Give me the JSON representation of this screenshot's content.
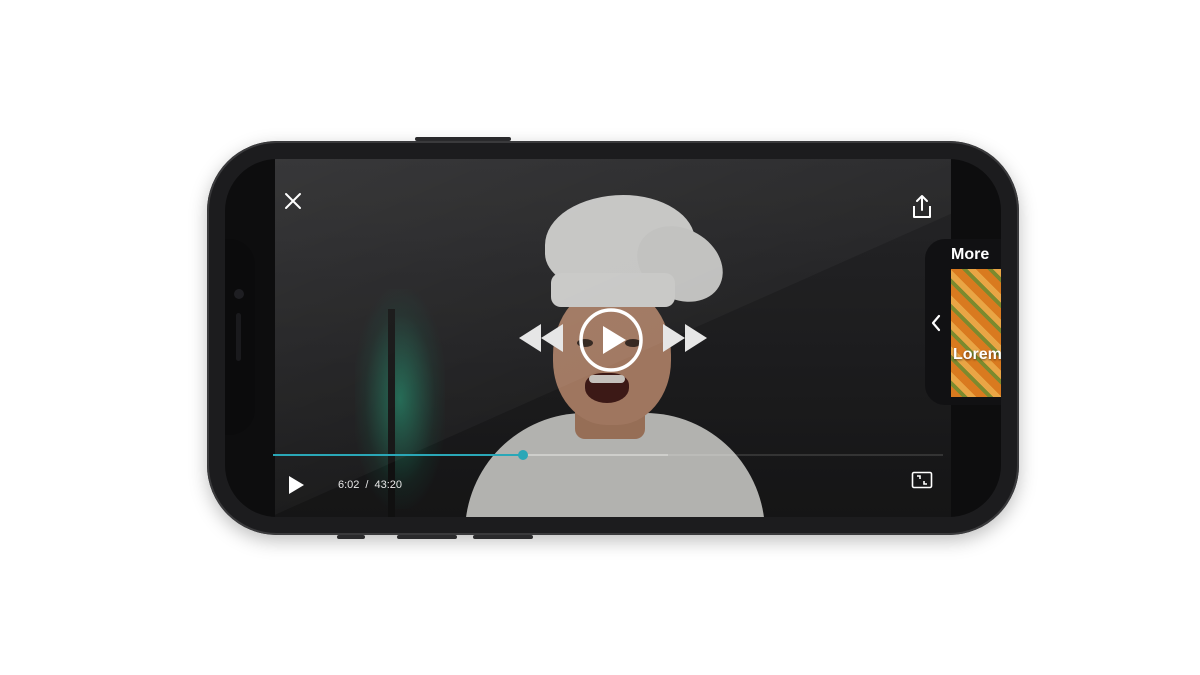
{
  "player": {
    "current_time": "6:02",
    "separator": "/",
    "duration": "43:20",
    "progress_fraction": 0.373,
    "buffer_fraction": 0.59,
    "accent_color": "#2aa7b7"
  },
  "icons": {
    "close": "close-icon",
    "share": "share-icon",
    "rewind": "rewind-icon",
    "play": "play-icon",
    "fast_forward": "fast-forward-icon",
    "exit_fullscreen": "exit-fullscreen-icon",
    "chevron": "chevron-left-icon"
  },
  "more_panel": {
    "label": "More",
    "thumb_title": "Lorem ipsum"
  }
}
